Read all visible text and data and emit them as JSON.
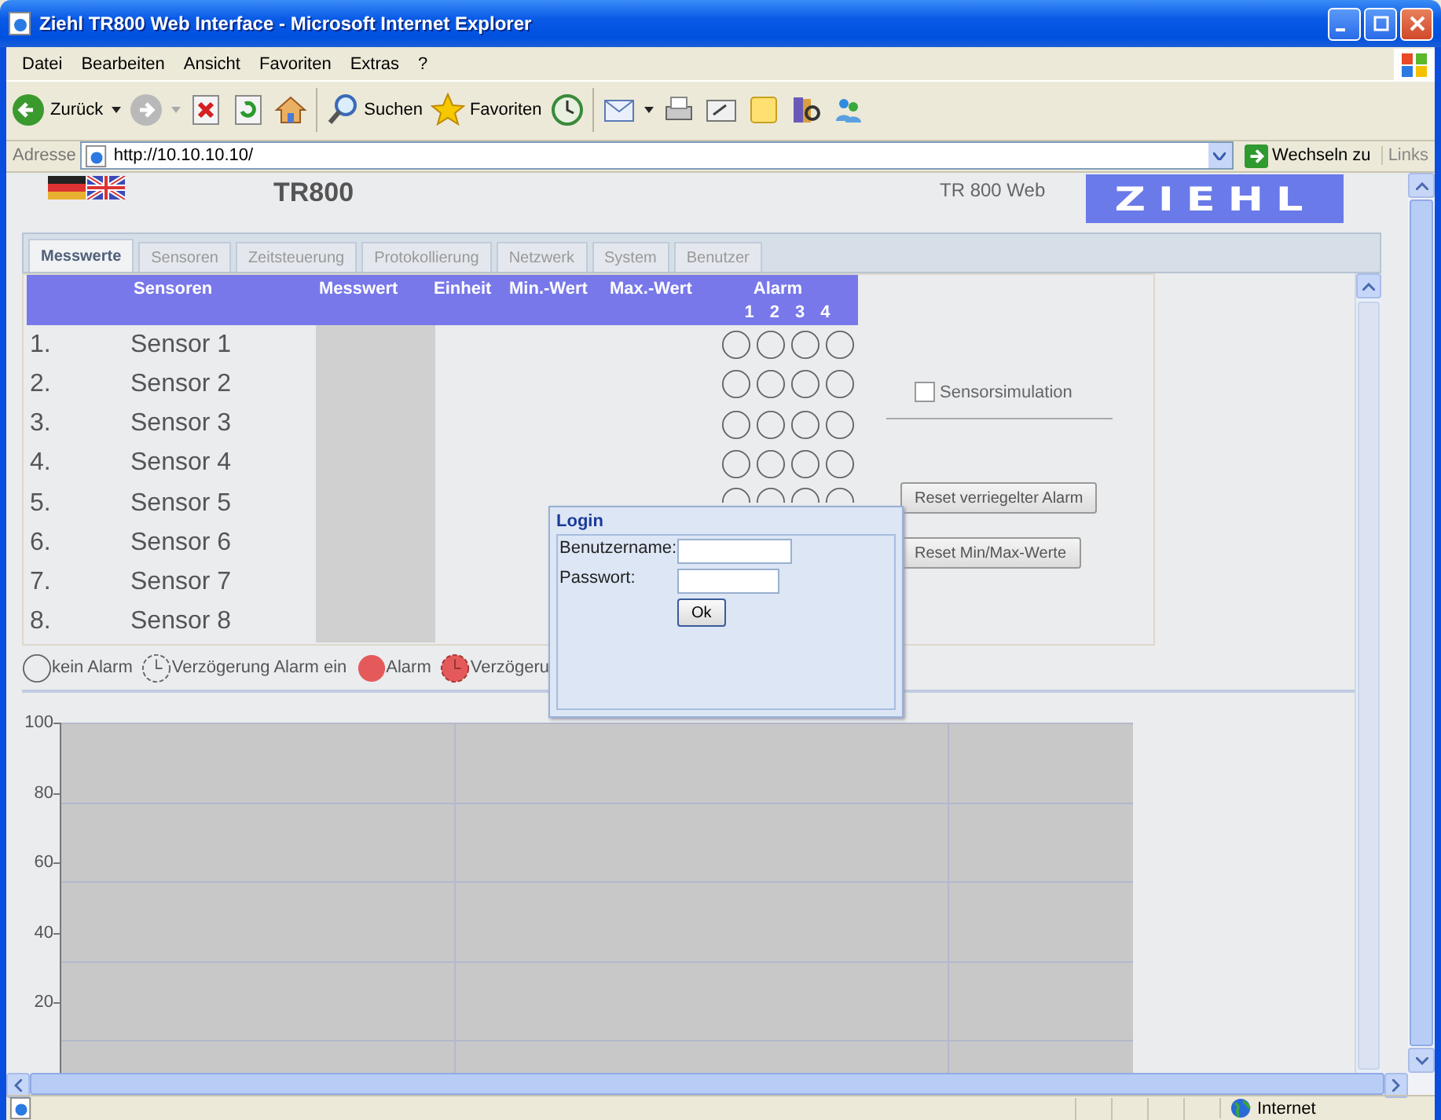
{
  "window": {
    "title": "Ziehl TR800 Web Interface - Microsoft Internet Explorer"
  },
  "menu": [
    "Datei",
    "Bearbeiten",
    "Ansicht",
    "Favoriten",
    "Extras",
    "?"
  ],
  "toolbar": [
    [
      {
        "kind": "back",
        "label": "Zurück",
        "dropdown": true
      },
      {
        "kind": "forward",
        "dropdown": true
      },
      {
        "kind": "stop"
      },
      {
        "kind": "refresh"
      },
      {
        "kind": "home"
      }
    ],
    [
      {
        "kind": "search",
        "label": "Suchen"
      },
      {
        "kind": "favorites",
        "label": "Favoriten"
      },
      {
        "kind": "history"
      }
    ],
    [
      {
        "kind": "mail",
        "dropdown": true
      },
      {
        "kind": "print"
      },
      {
        "kind": "edit"
      },
      {
        "kind": "note"
      },
      {
        "kind": "research"
      },
      {
        "kind": "messenger"
      }
    ]
  ],
  "address": {
    "label": "Adresse",
    "url": "http://10.10.10.10/",
    "go": "Wechseln zu",
    "links": "Links"
  },
  "page": {
    "title": "TR800",
    "subtitle": "TR 800 Web",
    "logo": "ZIEHL",
    "tabs": [
      {
        "label": "Messwerte",
        "selected": true
      },
      {
        "label": "Sensoren",
        "selected": false
      },
      {
        "label": "Zeitsteuerung",
        "selected": false
      },
      {
        "label": "Protokollierung",
        "selected": false
      },
      {
        "label": "Netzwerk",
        "selected": false
      },
      {
        "label": "System",
        "selected": false
      },
      {
        "label": "Benutzer",
        "selected": false
      }
    ],
    "table": {
      "columns": [
        "Sensoren",
        "Messwert",
        "Einheit",
        "Min.-Wert",
        "Max.-Wert",
        "Alarm"
      ],
      "alarm_numbers": [
        "1",
        "2",
        "3",
        "4"
      ],
      "rows": [
        {
          "index": "1.",
          "name": "Sensor 1",
          "alarms": [
            false,
            false,
            false,
            false
          ]
        },
        {
          "index": "2.",
          "name": "Sensor 2",
          "alarms": [
            false,
            false,
            false,
            false
          ]
        },
        {
          "index": "3.",
          "name": "Sensor 3",
          "alarms": [
            false,
            false,
            false,
            false
          ]
        },
        {
          "index": "4.",
          "name": "Sensor 4",
          "alarms": [
            false,
            false,
            false,
            false
          ]
        },
        {
          "index": "5.",
          "name": "Sensor 5",
          "alarms": [
            false,
            false,
            false,
            false
          ]
        },
        {
          "index": "6.",
          "name": "Sensor 6"
        },
        {
          "index": "7.",
          "name": "Sensor 7"
        },
        {
          "index": "8.",
          "name": "Sensor 8"
        }
      ]
    },
    "sensorsimulation": {
      "label": "Sensorsimulation",
      "checked": false
    },
    "buttons": [
      "Reset verriegelter Alarm",
      "Reset Min/Max-Werte"
    ],
    "legend": [
      {
        "kind": "none",
        "label": "kein Alarm"
      },
      {
        "kind": "delay",
        "label": "Verzögerung Alarm ein"
      },
      {
        "kind": "alarm",
        "label": "Alarm"
      },
      {
        "kind": "delay_alarm",
        "label": "Verzögeru"
      }
    ],
    "plot": {
      "y_labels": [
        "100",
        "80",
        "60",
        "40",
        "20"
      ]
    }
  },
  "login": {
    "title": "Login",
    "fields": [
      {
        "label": "Benutzername:"
      },
      {
        "label": "Passwort:"
      }
    ],
    "button": "Ok"
  },
  "status": {
    "zone": "Internet"
  }
}
